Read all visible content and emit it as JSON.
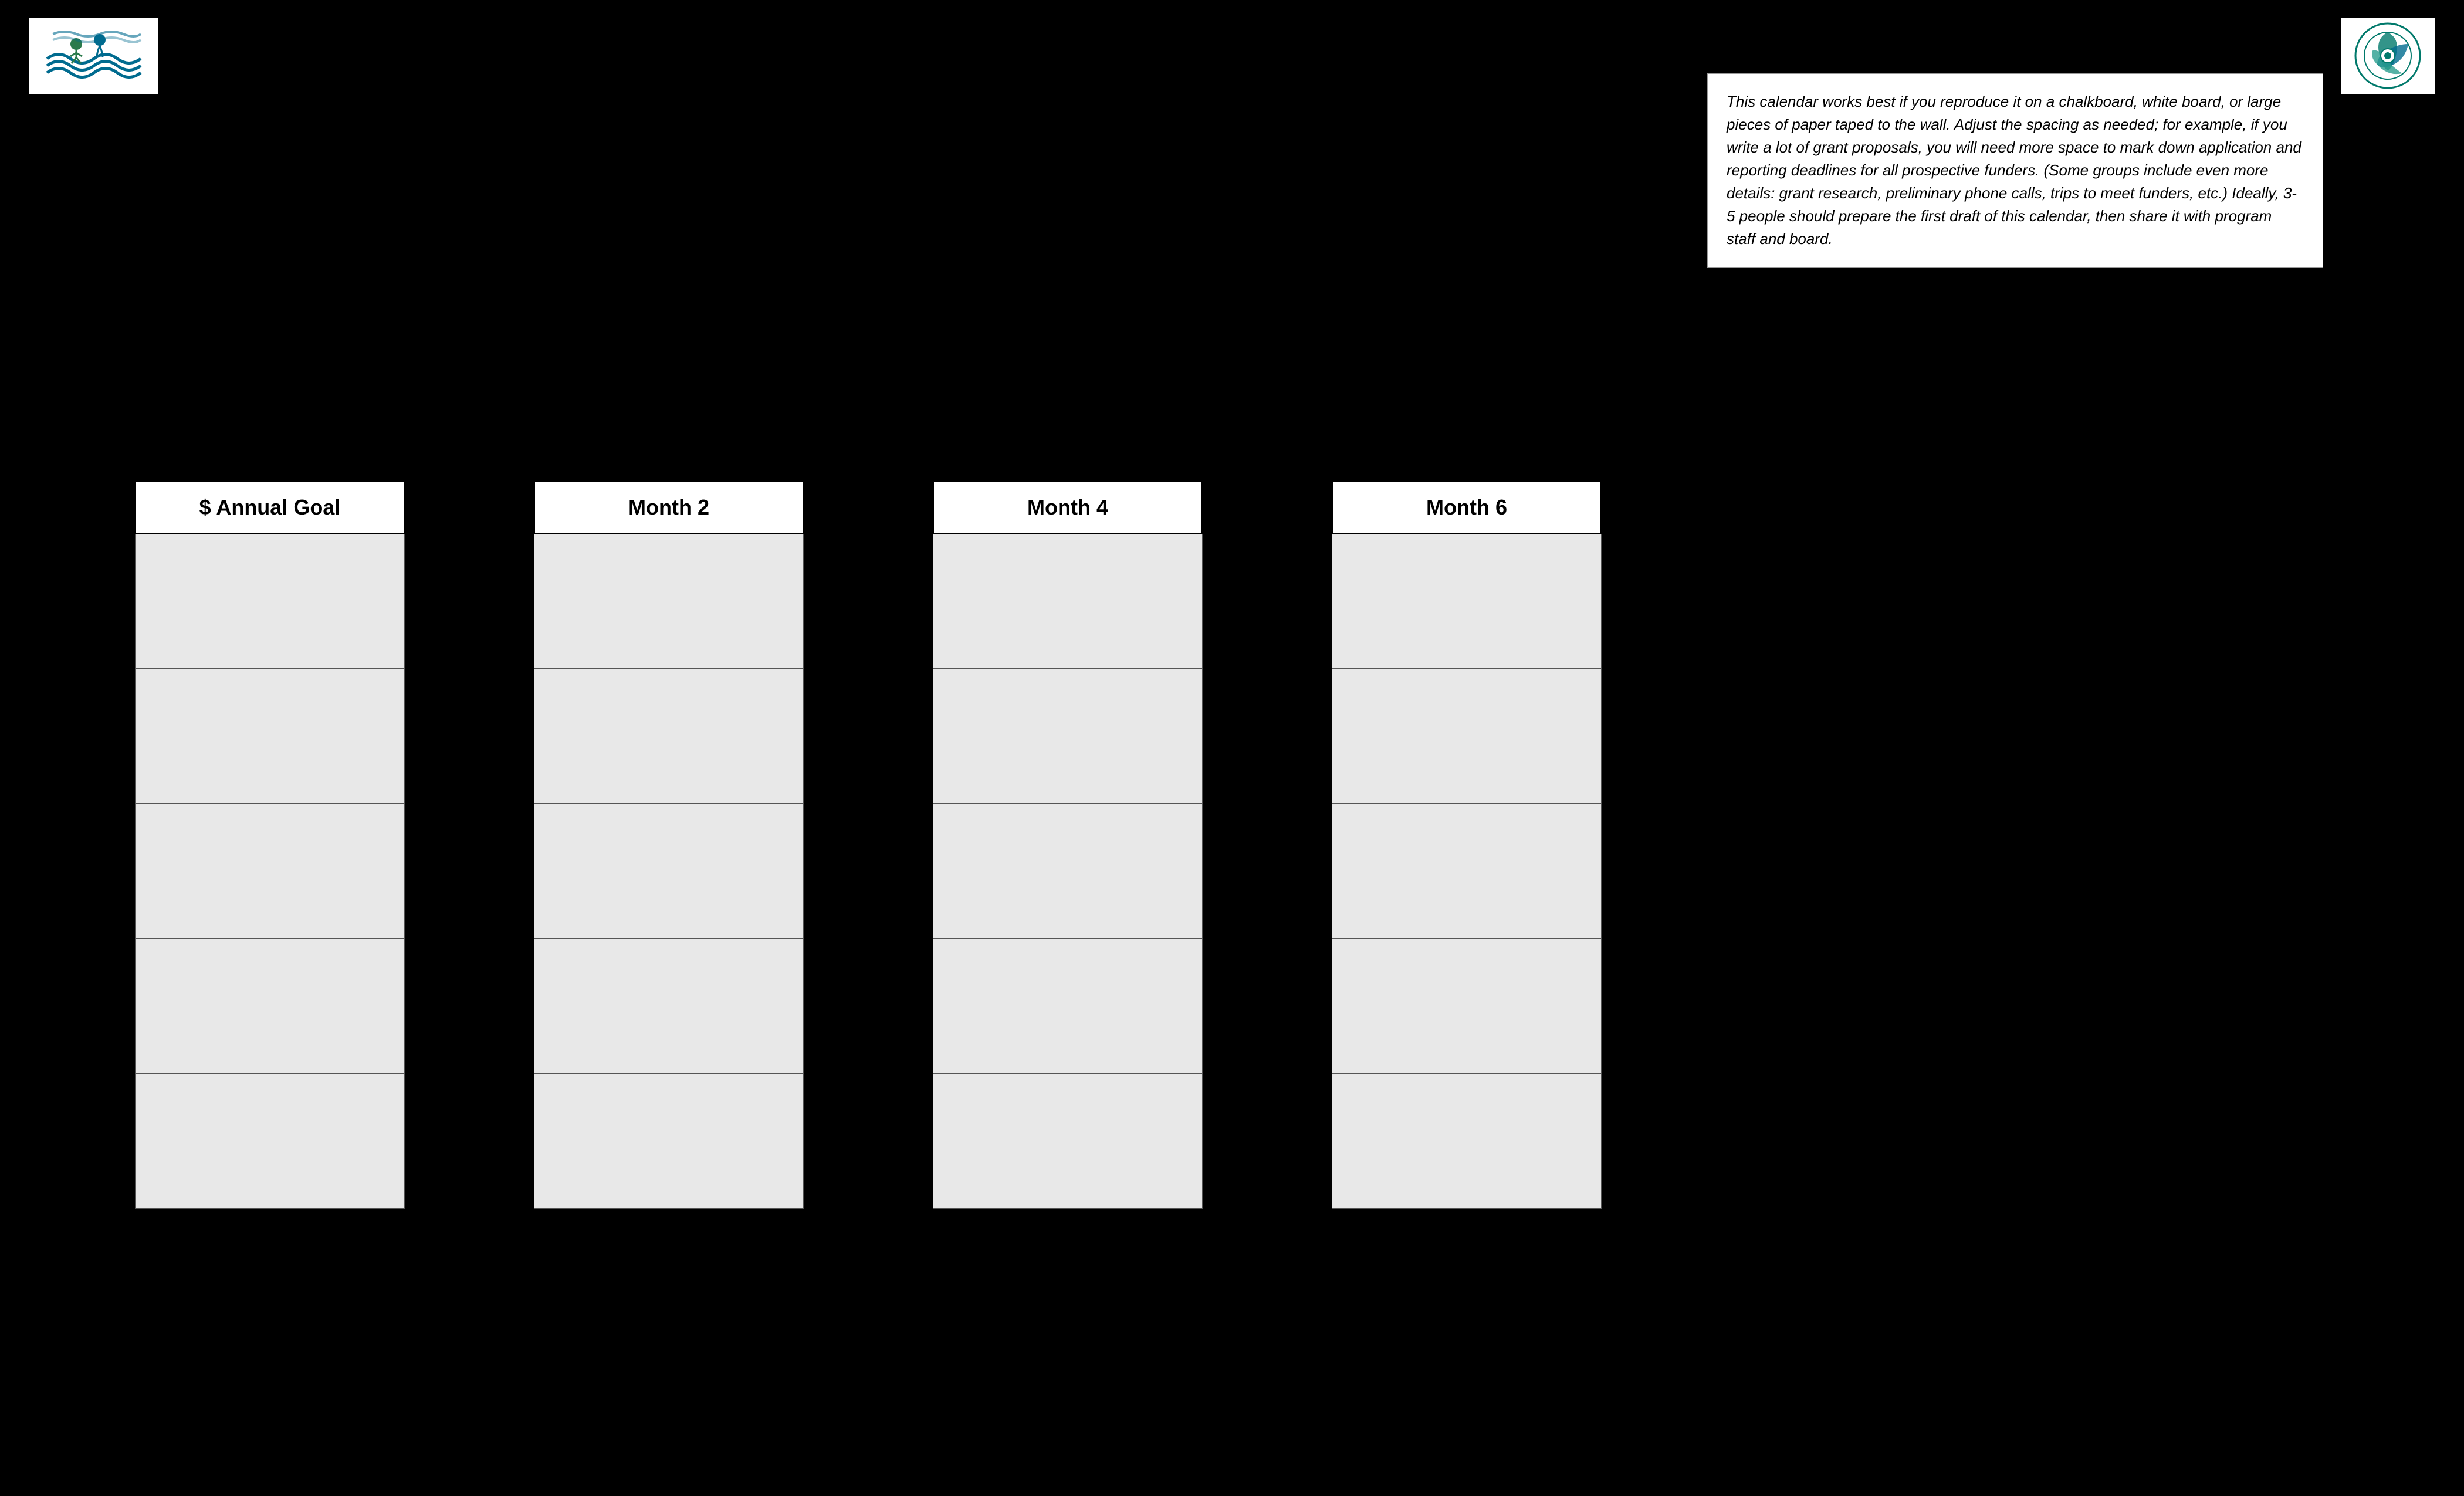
{
  "logos": {
    "left_alt": "Organization logo left",
    "right_alt": "Organization logo right"
  },
  "infobox": {
    "text": "This calendar works best if you reproduce it on a chalkboard, white board, or large pieces of paper taped to the wall.  Adjust the spacing as needed; for example, if you write a lot of grant proposals, you will need more space to mark down application and reporting deadlines for all prospective funders. (Some groups include even more details: grant research, preliminary phone calls, trips to meet funders, etc.)  Ideally, 3-5 people should prepare the first draft of this calendar, then share it with program staff and board."
  },
  "columns": [
    {
      "header": "$ Annual Goal",
      "id": "annual-goal"
    },
    {
      "header": "Month 2",
      "id": "month-2"
    },
    {
      "header": "Month 4",
      "id": "month-4"
    },
    {
      "header": "Month 6",
      "id": "month-6"
    }
  ],
  "rows_per_column": 5,
  "colors": {
    "background": "#000000",
    "cell_bg": "#e8e8e8",
    "header_bg": "#ffffff",
    "border": "#555555"
  }
}
